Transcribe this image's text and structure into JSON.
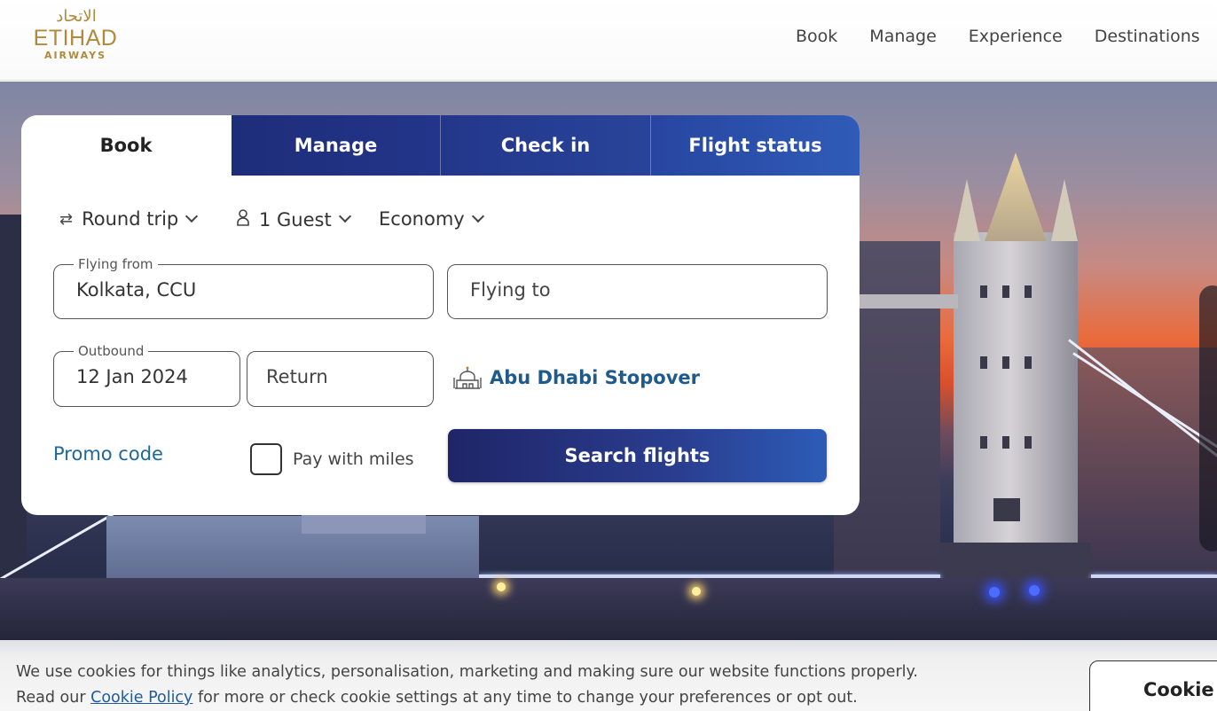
{
  "header": {
    "logo_arabic": "الاتحاد",
    "logo_text": "ETIHAD",
    "logo_sub": "AIRWAYS",
    "nav": [
      "Book",
      "Manage",
      "Experience",
      "Destinations"
    ]
  },
  "booking": {
    "tabs": [
      "Book",
      "Manage",
      "Check in",
      "Flight status"
    ],
    "active_tab": "Book",
    "trip_type": "Round trip",
    "guests": "1 Guest",
    "cabin": "Economy",
    "from": {
      "label": "Flying from",
      "value": "Kolkata, CCU"
    },
    "to": {
      "placeholder": "Flying to"
    },
    "outbound": {
      "label": "Outbound",
      "value": "12 Jan 2024"
    },
    "return": {
      "placeholder": "Return"
    },
    "stopover": "Abu Dhabi Stopover",
    "promo": "Promo code",
    "miles": "Pay with miles",
    "search": "Search flights"
  },
  "cookie": {
    "line1": "We use cookies for things like analytics, personalisation, marketing and making sure our website functions properly.",
    "line2_pre": "Read our",
    "policy_link": "Cookie Policy",
    "line2_post": "for more or check cookie settings at any time to change your preferences or opt out.",
    "button": "Cookie"
  },
  "colors": {
    "brand_gold": "#b08a3a",
    "tab_blue": "#23358a",
    "search_dark": "#1f2567",
    "search_light": "#2c5cb7",
    "link_blue": "#1f6797"
  }
}
